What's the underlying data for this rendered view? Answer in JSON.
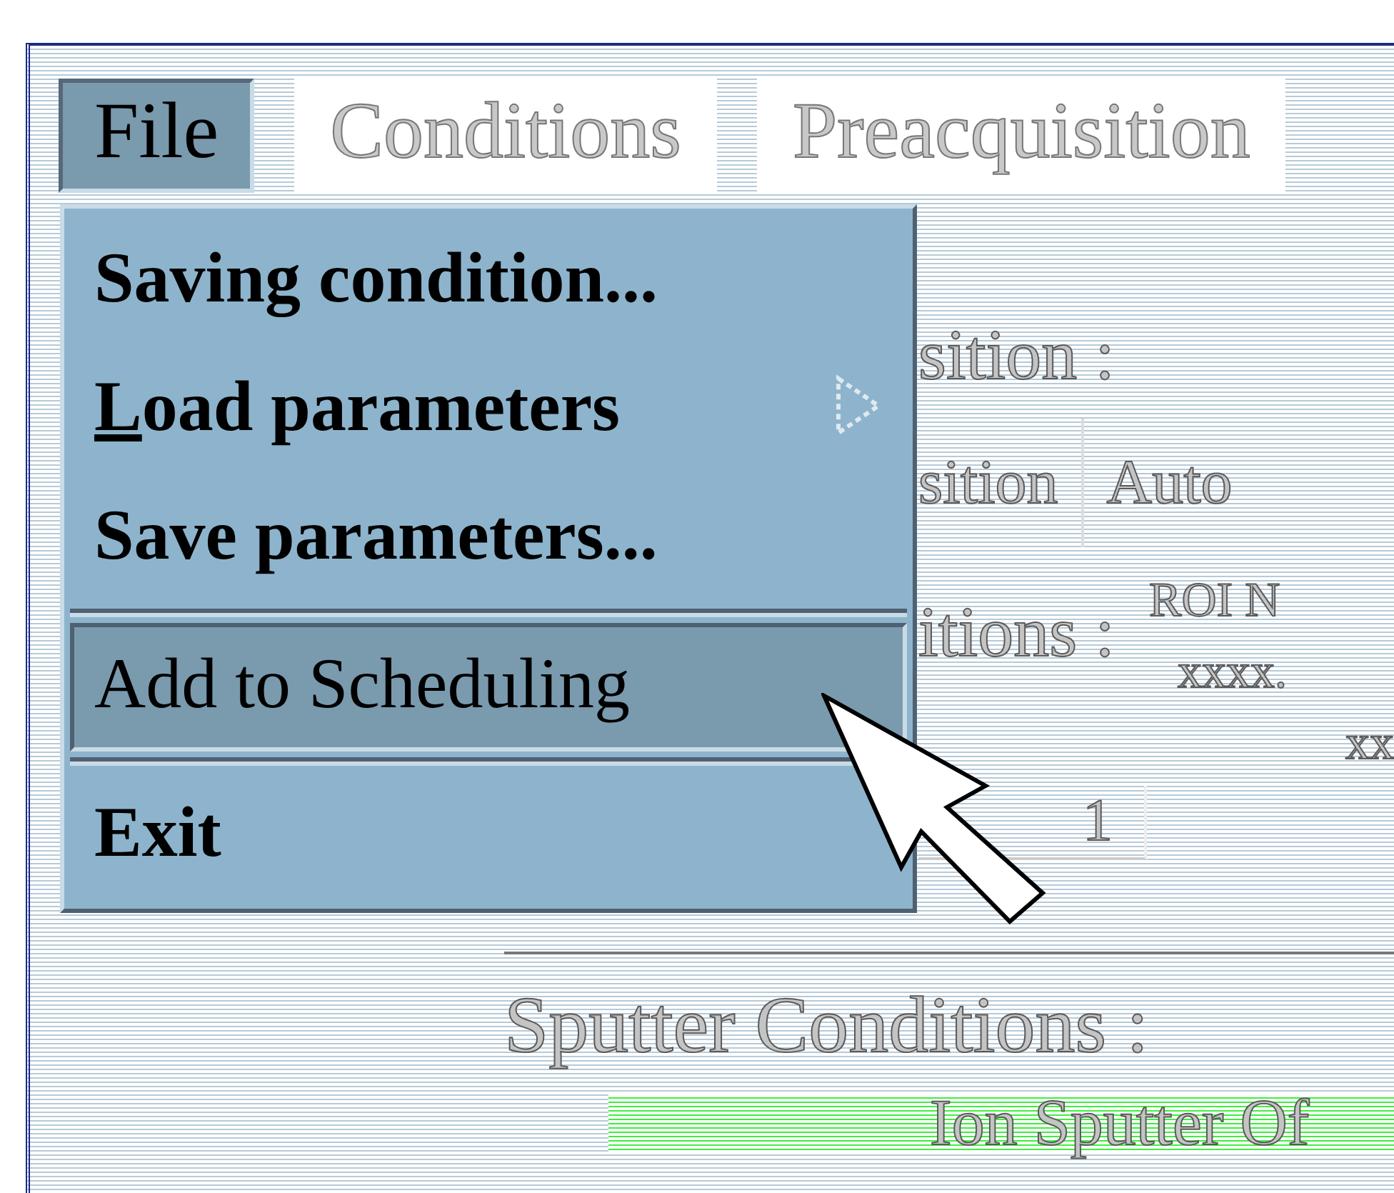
{
  "menubar": [
    {
      "label": "File",
      "selected": true
    },
    {
      "label": "Conditions",
      "selected": false
    },
    {
      "label": "Preacquisition",
      "selected": false
    }
  ],
  "file_menu": [
    {
      "kind": "item",
      "label": "Saving condition...",
      "mnemonic": false,
      "submenu": false,
      "selected": false
    },
    {
      "kind": "item",
      "label": "Load parameters",
      "mnemonic": true,
      "submenu": true,
      "selected": false
    },
    {
      "kind": "item",
      "label": "Save parameters...",
      "mnemonic": false,
      "submenu": false,
      "selected": false
    },
    {
      "kind": "separator"
    },
    {
      "kind": "item",
      "label": "Add to Scheduling",
      "mnemonic": false,
      "submenu": false,
      "selected": true
    },
    {
      "kind": "separator"
    },
    {
      "kind": "item",
      "label": "Exit",
      "mnemonic": false,
      "submenu": false,
      "selected": false
    }
  ],
  "background": {
    "position_heading": "sition :",
    "position_label": "sition",
    "auto_label": "Auto",
    "roi_label": "ROI N",
    "conditions_heading": "itions :",
    "roi_value": "xxxx.",
    "value_2": "xx",
    "field_value": "1",
    "sputter_heading": "Sputter Conditions :",
    "sputter_status": "Ion Sputter Of"
  }
}
